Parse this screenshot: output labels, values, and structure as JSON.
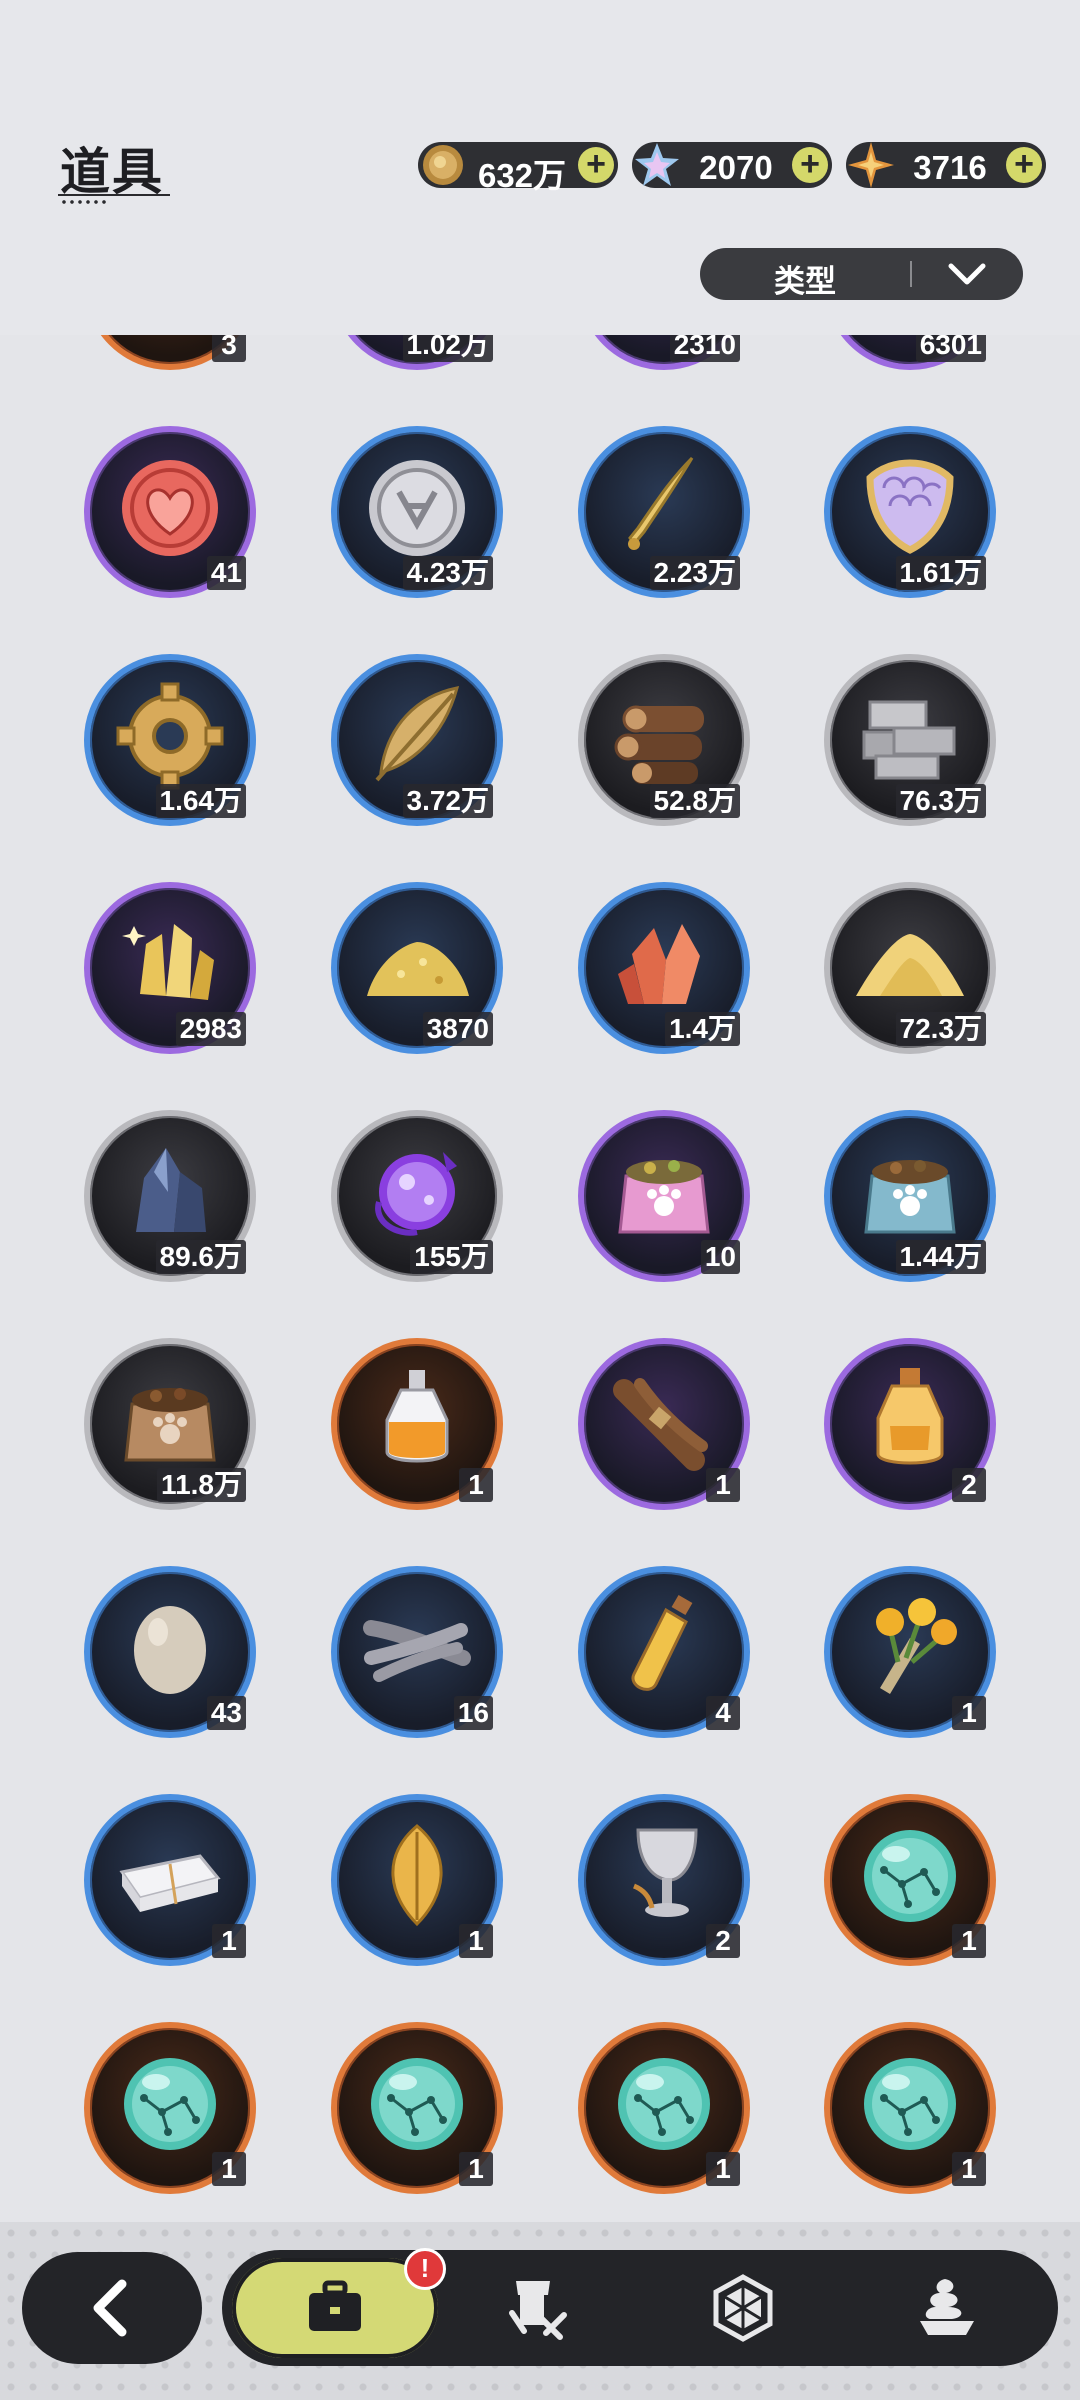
{
  "header": {
    "title": "道具",
    "currencies": [
      {
        "icon": "gold-coin-icon",
        "value": "632万"
      },
      {
        "icon": "crystal-icon",
        "value": "2070"
      },
      {
        "icon": "star-gem-icon",
        "value": "3716"
      }
    ],
    "plus_label": "+",
    "filter": {
      "label": "类型",
      "icon": "chevron-down-icon"
    }
  },
  "partial_row_labels": [
    "3",
    "1.02万",
    "2310",
    "6301"
  ],
  "items": [
    {
      "icon": "heart-coin-icon",
      "rarity": "purple",
      "qty": "41"
    },
    {
      "icon": "silver-coin-icon",
      "rarity": "blue",
      "qty": "4.23万"
    },
    {
      "icon": "golden-blade-icon",
      "rarity": "blue",
      "qty": "2.23万"
    },
    {
      "icon": "scale-shield-icon",
      "rarity": "blue",
      "qty": "1.61万"
    },
    {
      "icon": "gear-icon",
      "rarity": "blue",
      "qty": "1.64万"
    },
    {
      "icon": "feather-icon",
      "rarity": "blue",
      "qty": "3.72万"
    },
    {
      "icon": "wood-logs-icon",
      "rarity": "gray",
      "qty": "52.8万"
    },
    {
      "icon": "stone-bricks-icon",
      "rarity": "gray",
      "qty": "76.3万"
    },
    {
      "icon": "gold-crystals-icon",
      "rarity": "purple",
      "qty": "2983"
    },
    {
      "icon": "gold-dust-icon",
      "rarity": "blue",
      "qty": "3870"
    },
    {
      "icon": "red-crystal-icon",
      "rarity": "blue",
      "qty": "1.4万"
    },
    {
      "icon": "sand-pile-icon",
      "rarity": "gray",
      "qty": "72.3万"
    },
    {
      "icon": "dark-crystal-icon",
      "rarity": "gray",
      "qty": "89.6万"
    },
    {
      "icon": "purple-orb-icon",
      "rarity": "gray",
      "qty": "155万"
    },
    {
      "icon": "pink-pet-food-bag-icon",
      "rarity": "purple",
      "qty": "10"
    },
    {
      "icon": "blue-pet-food-bag-icon",
      "rarity": "blue",
      "qty": "1.44万"
    },
    {
      "icon": "brown-pet-food-bag-icon",
      "rarity": "gray",
      "qty": "11.8万"
    },
    {
      "icon": "orange-potion-icon",
      "rarity": "orange",
      "qty": "1"
    },
    {
      "icon": "hair-bundle-icon",
      "rarity": "purple",
      "qty": "1"
    },
    {
      "icon": "amber-potion-icon",
      "rarity": "purple",
      "qty": "2"
    },
    {
      "icon": "egg-icon",
      "rarity": "blue",
      "qty": "43"
    },
    {
      "icon": "feather-bundle-icon",
      "rarity": "blue",
      "qty": "16"
    },
    {
      "icon": "vial-icon",
      "rarity": "blue",
      "qty": "4"
    },
    {
      "icon": "flower-bouquet-icon",
      "rarity": "blue",
      "qty": "1"
    },
    {
      "icon": "folded-towel-icon",
      "rarity": "blue",
      "qty": "1"
    },
    {
      "icon": "golden-leaf-icon",
      "rarity": "blue",
      "qty": "1"
    },
    {
      "icon": "silver-goblet-icon",
      "rarity": "blue",
      "qty": "2"
    },
    {
      "icon": "constellation-orb-icon",
      "rarity": "orange",
      "qty": "1"
    },
    {
      "icon": "constellation-orb-icon",
      "rarity": "orange",
      "qty": "1"
    },
    {
      "icon": "constellation-orb-icon",
      "rarity": "orange",
      "qty": "1"
    },
    {
      "icon": "constellation-orb-icon",
      "rarity": "orange",
      "qty": "1"
    },
    {
      "icon": "constellation-orb-icon",
      "rarity": "orange",
      "qty": "1"
    }
  ],
  "bottom_nav": {
    "back_icon": "back-arrow-icon",
    "tabs": [
      {
        "icon": "briefcase-icon",
        "active": true,
        "badge": "!"
      },
      {
        "icon": "gear-equipment-icon",
        "active": false
      },
      {
        "icon": "hexagon-icon",
        "active": false
      },
      {
        "icon": "dessert-icon",
        "active": false
      }
    ]
  },
  "colors": {
    "background": "#e4e5e9",
    "accent": "#d4d975",
    "rarity_purple": "#9c6ae0",
    "rarity_blue": "#4a8fe0",
    "rarity_gray": "#b9b9bd",
    "rarity_orange": "#e07a3a",
    "badge": "#e0393a"
  }
}
